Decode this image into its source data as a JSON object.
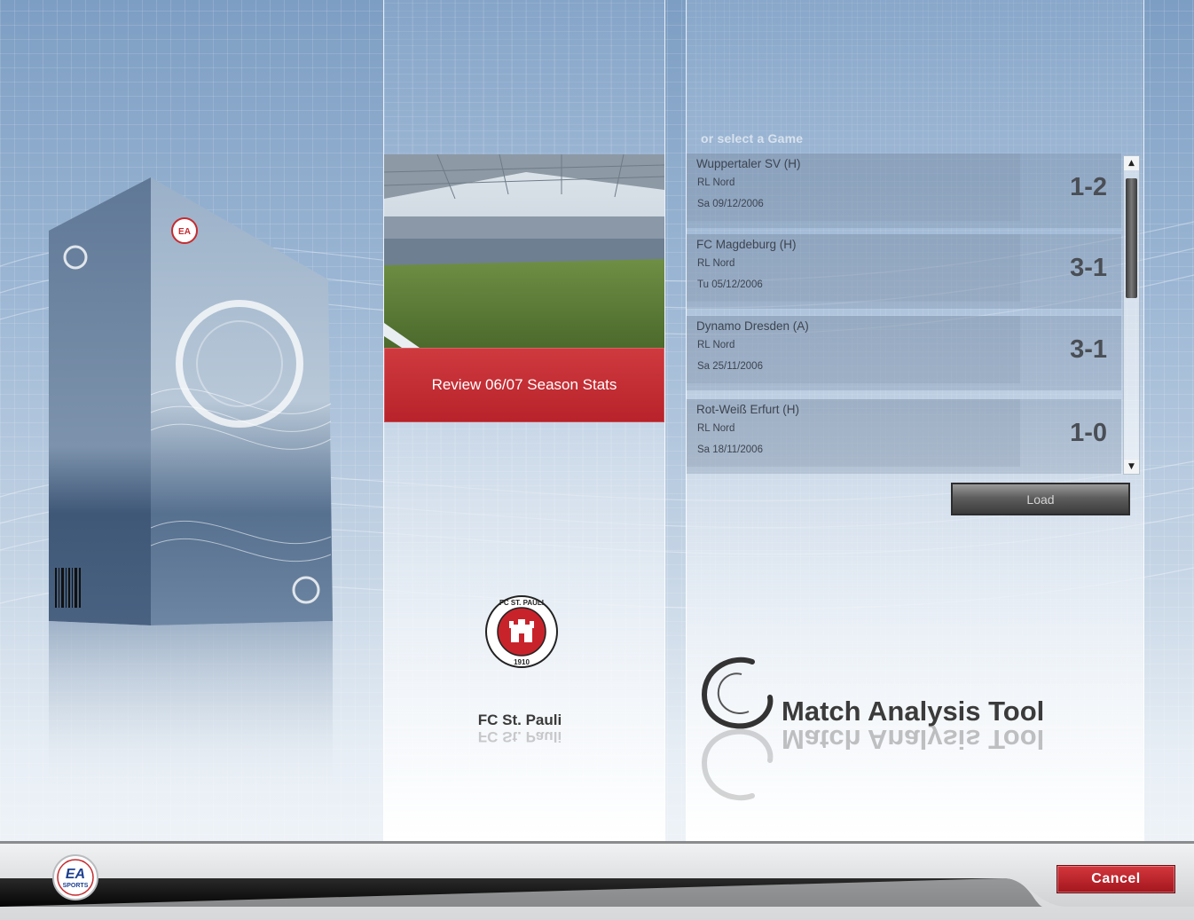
{
  "colors": {
    "accent_red": "#b8222a",
    "cancel_red": "#b8222a",
    "background_blue": "#9ab5d3",
    "text_dark": "#3d4450"
  },
  "center": {
    "review_label": "Review 06/07 Season Stats",
    "club_name": "FC St. Pauli",
    "club_crest_top": "FC ST. PAULI",
    "club_crest_year": "1910"
  },
  "games": {
    "select_label": "or select a Game",
    "items": [
      {
        "name": "Wuppertaler SV (H)",
        "league": "RL Nord",
        "date": "Sa 09/12/2006",
        "score": "1-2"
      },
      {
        "name": "FC Magdeburg (H)",
        "league": "RL Nord",
        "date": "Tu 05/12/2006",
        "score": "3-1"
      },
      {
        "name": "Dynamo Dresden (A)",
        "league": "RL Nord",
        "date": "Sa 25/11/2006",
        "score": "3-1"
      },
      {
        "name": "Rot-Weiß Erfurt (H)",
        "league": "RL Nord",
        "date": "Sa 18/11/2006",
        "score": "1-0"
      }
    ],
    "load_label": "Load"
  },
  "branding": {
    "tool_title": "Match Analysis Tool",
    "ea_logo_line1": "EA",
    "ea_logo_line2": "SPORTS",
    "box_logo": "EA"
  },
  "footer": {
    "cancel_label": "Cancel"
  },
  "icons": {
    "scroll_up": "triangle-up-icon",
    "scroll_down": "triangle-down-icon"
  }
}
